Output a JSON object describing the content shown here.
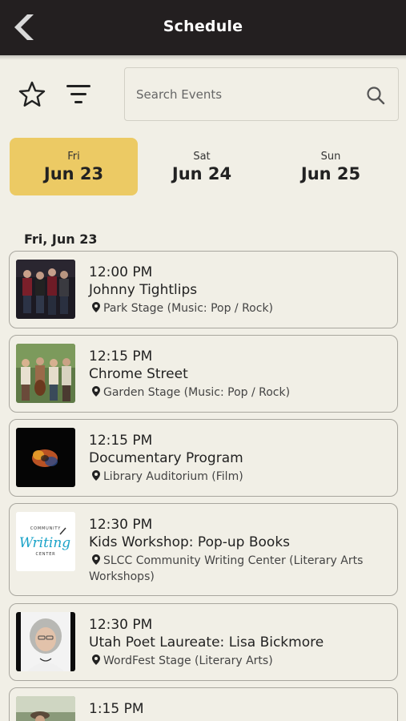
{
  "header": {
    "title": "Schedule",
    "back_icon": "chevron-left-icon"
  },
  "toolbar": {
    "favorites_icon": "star-outline-icon",
    "filter_icon": "filter-lines-icon",
    "search_placeholder": "Search Events",
    "search_value": "",
    "search_icon": "search-icon"
  },
  "days": [
    {
      "dow": "Fri",
      "date": "Jun 23",
      "active": true
    },
    {
      "dow": "Sat",
      "date": "Jun 24",
      "active": false
    },
    {
      "dow": "Sun",
      "date": "Jun 25",
      "active": false
    }
  ],
  "section_heading": "Fri, Jun 23",
  "events": [
    {
      "time": "12:00 PM",
      "title": "Johnny Tightlips",
      "location": "Park Stage (Music: Pop / Rock)"
    },
    {
      "time": "12:15 PM",
      "title": "Chrome Street",
      "location": "Garden Stage (Music: Pop / Rock)"
    },
    {
      "time": "12:15 PM",
      "title": "Documentary Program",
      "location": "Library Auditorium (Film)"
    },
    {
      "time": "12:30 PM",
      "title": "Kids Workshop: Pop-up Books",
      "location": "SLCC Community Writing Center (Literary Arts Workshops)"
    },
    {
      "time": "12:30 PM",
      "title": "Utah Poet Laureate: Lisa Bickmore",
      "location": "WordFest Stage (Literary Arts)"
    },
    {
      "time": "1:15 PM",
      "title": "",
      "location": ""
    }
  ],
  "logo_text": {
    "top": "COMMUNITY",
    "main": "Writing",
    "bottom": "CENTER"
  },
  "colors": {
    "header_bg": "#231f20",
    "page_bg": "#f1efe6",
    "active_tab": "#ecca64",
    "card_border": "#a8a69e"
  }
}
